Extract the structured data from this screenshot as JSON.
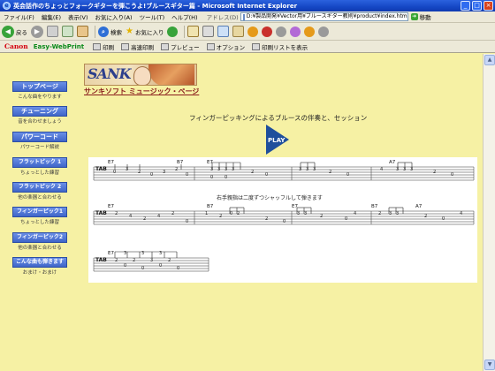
{
  "window": {
    "title": "英会話作のちょっとフォークギターを弾こうよ!ブルースギター篇 - Microsoft Internet Explorer",
    "minimize": "_",
    "maximize": "□",
    "close": "×"
  },
  "menubar": {
    "items": [
      "ファイル(F)",
      "編集(E)",
      "表示(V)",
      "お気に入り(A)",
      "ツール(T)",
      "ヘルプ(H)"
    ],
    "address_label": "アドレス(D)",
    "address_value": "D:¥製品開発¥Vector用¥ブルースギター教則¥product¥index.htm",
    "go_label": "移動"
  },
  "toolbar": {
    "back_label": "戻る",
    "search_label": "検索",
    "favorites_label": "お気に入り"
  },
  "canonbar": {
    "brand": "Canon",
    "product": "Easy-WebPrint",
    "print_label": "印刷",
    "hq_print_label": "高速印刷",
    "preview_label": "プレビュー",
    "options_label": "オプション",
    "print_list_label": "印刷リストを表示"
  },
  "nav": [
    {
      "label": "トップページ",
      "sub": "こんな曲をやります"
    },
    {
      "label": "チューニング",
      "sub": "音を合わせましょう"
    },
    {
      "label": "パワーコード",
      "sub": "パワーコード解説"
    },
    {
      "label": "フラットピック 1",
      "sub": "ちょっとした練習"
    },
    {
      "label": "フラットピック 2",
      "sub": "他の楽器と合わせる"
    },
    {
      "label": "フィンガーピック1",
      "sub": "ちょっとした練習"
    },
    {
      "label": "フィンガーピック2",
      "sub": "他の楽器と合わせる"
    },
    {
      "label": "こんな曲も弾きます",
      "sub": "おまけ・おまけ"
    }
  ],
  "logo": {
    "text": "SANK",
    "caption": "サンキソフト ミュージック・ページ"
  },
  "main": {
    "heading": "フィンガーピッキングによるブルースの伴奏と、セッション",
    "play_label": "PLAY",
    "tab_note": "右手親指は二度ずつシャッフルして弾きます",
    "tab_label": "TAB",
    "chords": [
      "E7",
      "B7",
      "E7",
      "A7",
      "E7",
      "B7",
      "E7",
      "B7",
      "A7",
      "E7"
    ]
  },
  "colors": {
    "page_bg": "#f6f1a4",
    "nav_blue": "#3f66c8",
    "play_blue": "#1f4f9c"
  }
}
